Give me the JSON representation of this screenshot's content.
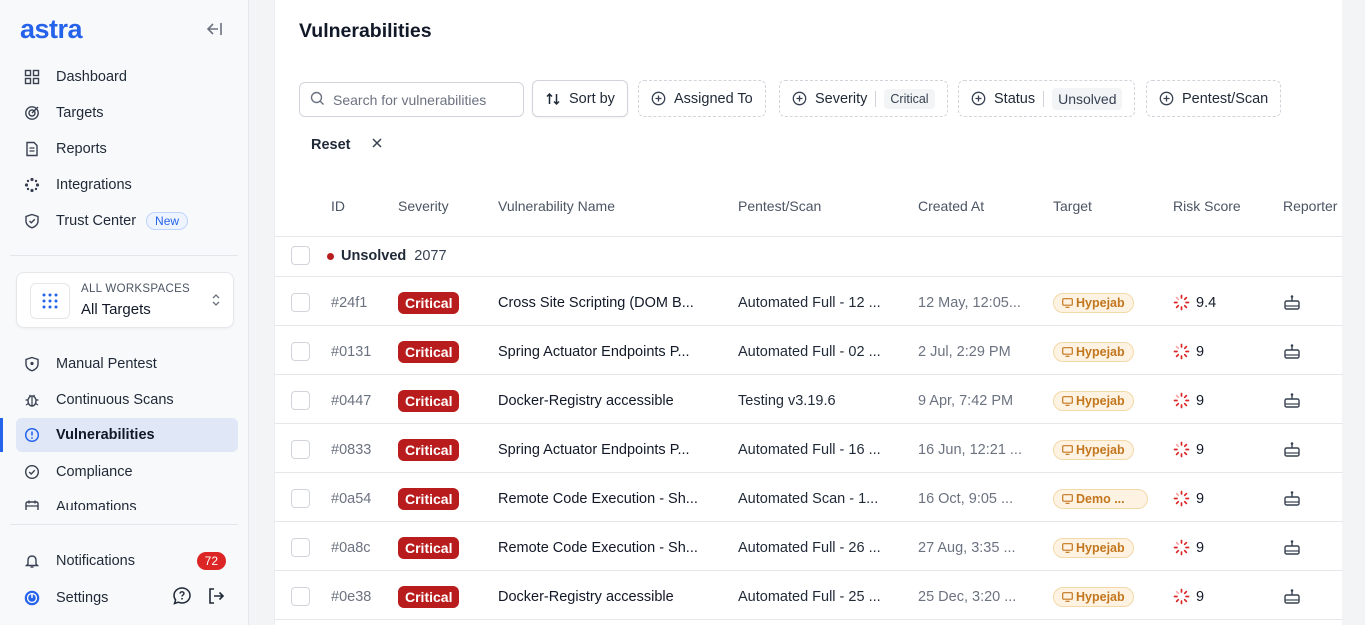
{
  "sidebar": {
    "logo": "astra",
    "nav_top": [
      {
        "label": "Dashboard",
        "icon": "grid-icon"
      },
      {
        "label": "Targets",
        "icon": "target-icon"
      },
      {
        "label": "Reports",
        "icon": "report-icon"
      },
      {
        "label": "Integrations",
        "icon": "integrations-icon"
      },
      {
        "label": "Trust Center",
        "icon": "shield-check-icon",
        "badge": "New"
      }
    ],
    "workspace": {
      "small": "ALL WORKSPACES",
      "big": "All Targets"
    },
    "nav_mid": [
      {
        "label": "Manual Pentest",
        "icon": "shield-icon"
      },
      {
        "label": "Continuous Scans",
        "icon": "bug-icon"
      },
      {
        "label": "Vulnerabilities",
        "icon": "alert-circle-icon",
        "active": true
      },
      {
        "label": "Compliance",
        "icon": "check-circle-icon"
      },
      {
        "label": "Automations",
        "icon": "calendar-icon"
      }
    ],
    "notifications": {
      "label": "Notifications",
      "count": "72"
    },
    "settings": {
      "label": "Settings"
    }
  },
  "main": {
    "title": "Vulnerabilities",
    "search_placeholder": "Search for vulnerabilities",
    "filters": {
      "sort_by": "Sort by",
      "assigned_to": "Assigned To",
      "severity": "Severity",
      "severity_value": "Critical",
      "status": "Status",
      "status_value": "Unsolved",
      "pentest_scan": "Pentest/Scan",
      "reset": "Reset"
    },
    "columns": {
      "id": "ID",
      "severity": "Severity",
      "name": "Vulnerability Name",
      "scan": "Pentest/Scan",
      "created": "Created At",
      "target": "Target",
      "risk": "Risk Score",
      "reporter": "Reporter"
    },
    "group": {
      "label": "Unsolved",
      "count": "2077"
    },
    "rows": [
      {
        "id": "#24f1",
        "severity": "Critical",
        "name": "Cross Site Scripting (DOM B...",
        "scan": "Automated Full - 12 ...",
        "created": "12 May, 12:05...",
        "target": "Hypejab",
        "risk": "9.4"
      },
      {
        "id": "#0131",
        "severity": "Critical",
        "name": "Spring Actuator Endpoints P...",
        "scan": "Automated Full - 02 ...",
        "created": "2 Jul, 2:29 PM",
        "target": "Hypejab",
        "risk": "9"
      },
      {
        "id": "#0447",
        "severity": "Critical",
        "name": "Docker-Registry accessible",
        "scan": "Testing v3.19.6",
        "created": "9 Apr, 7:42 PM",
        "target": "Hypejab",
        "risk": "9"
      },
      {
        "id": "#0833",
        "severity": "Critical",
        "name": "Spring Actuator Endpoints P...",
        "scan": "Automated Full - 16 ...",
        "created": "16 Jun, 12:21 ...",
        "target": "Hypejab",
        "risk": "9"
      },
      {
        "id": "#0a54",
        "severity": "Critical",
        "name": "Remote Code Execution - Sh...",
        "scan": "Automated Scan - 1...",
        "created": "16 Oct, 9:05 ...",
        "target": "Demo ...",
        "risk": "9"
      },
      {
        "id": "#0a8c",
        "severity": "Critical",
        "name": "Remote Code Execution - Sh...",
        "scan": "Automated Full - 26 ...",
        "created": "27 Aug, 3:35 ...",
        "target": "Hypejab",
        "risk": "9"
      },
      {
        "id": "#0e38",
        "severity": "Critical",
        "name": "Docker-Registry accessible",
        "scan": "Automated Full - 25 ...",
        "created": "25 Dec, 3:20 ...",
        "target": "Hypejab",
        "risk": "9"
      }
    ]
  },
  "colors": {
    "accent": "#2563eb",
    "critical": "#b91c1c",
    "target_text": "#c2761e",
    "target_bg": "#fef3e2"
  }
}
